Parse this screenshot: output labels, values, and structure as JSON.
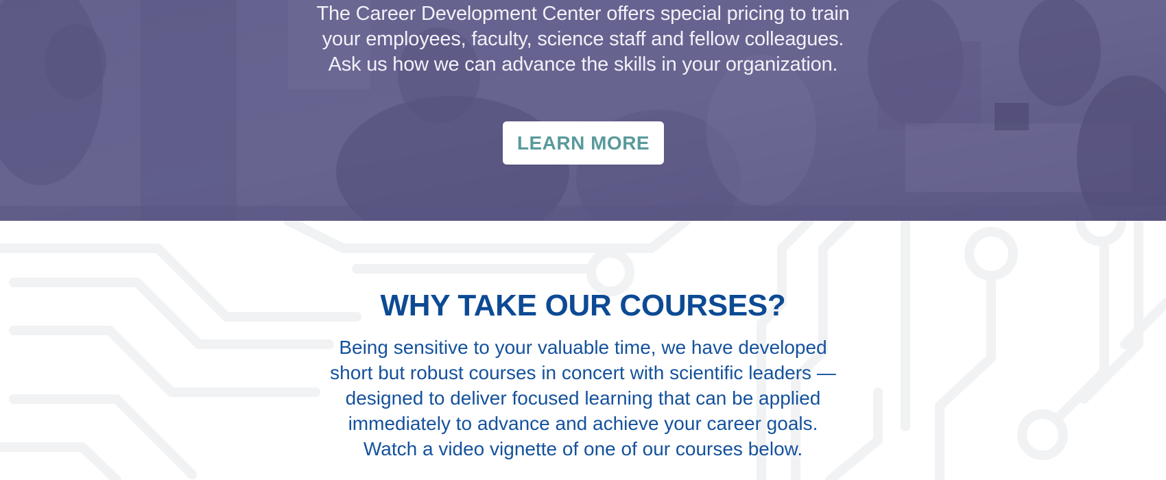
{
  "hero": {
    "lines": [
      "The Career Development Center offers special pricing to train",
      "your employees, faculty, science staff and fellow colleagues.",
      "Ask us how we can advance the skills in your organization."
    ],
    "button_label": "LEARN MORE",
    "overlay_color": "#5e5a86",
    "button_text_color": "#5a9a9c"
  },
  "why": {
    "title": "WHY TAKE OUR COURSES?",
    "lines": [
      "Being sensitive to your valuable time, we have developed",
      "short but robust courses in concert with scientific leaders —",
      "designed to deliver focused learning that can be applied",
      "immediately to advance and achieve your career goals.",
      "Watch a video vignette of one of our courses below."
    ],
    "title_color": "#0d4a94",
    "text_color": "#14519c"
  }
}
